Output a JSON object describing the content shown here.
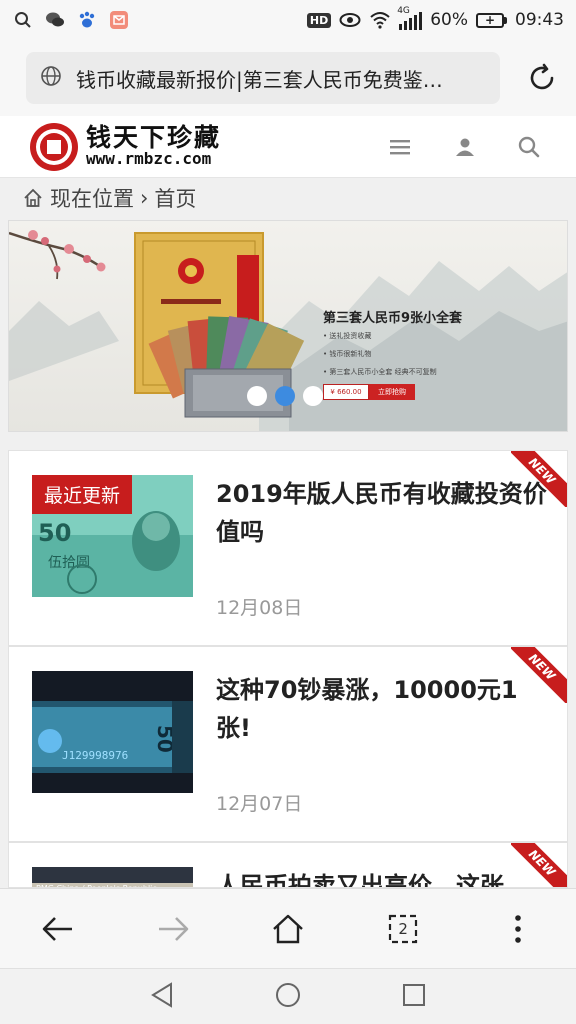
{
  "status_bar": {
    "hd": "HD",
    "network": "4G",
    "battery": "60%",
    "time": "09:43"
  },
  "browser": {
    "url_title": "钱币收藏最新报价|第三套人民币免费鉴…"
  },
  "site": {
    "logo_title": "钱天下珍藏",
    "logo_url": "www.rmbzc.com",
    "brand_color": "#c71d1d"
  },
  "breadcrumb": {
    "label": "现在位置",
    "separator": "›",
    "current": "首页"
  },
  "banner": {
    "title": "第三套人民币9张小全套",
    "bullets": [
      "• 送礼投资收藏",
      "• 钱币很新礼物",
      "• 第三套人民币小全套 经典不可复制"
    ],
    "price": "¥ 660.00",
    "buy": "立即抢购",
    "slides": 3,
    "active_slide": 2
  },
  "articles": [
    {
      "tag": "最近更新",
      "title": "2019年版人民币有收藏投资价值吗",
      "date": "12月08日",
      "ribbon": "NEW"
    },
    {
      "tag": "",
      "title": "这种70钞暴涨，10000元1张!",
      "date": "12月07日",
      "ribbon": "NEW"
    },
    {
      "tag": "",
      "title": "人民币拍卖又出高价，这张",
      "date": "",
      "ribbon": "NEW"
    }
  ]
}
